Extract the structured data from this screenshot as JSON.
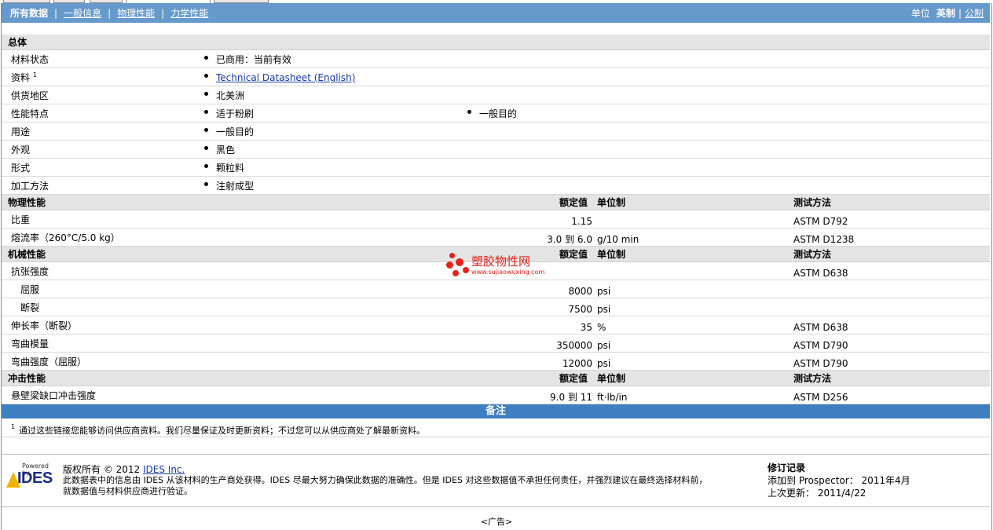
{
  "nav": {
    "items": [
      "所有数据",
      "一般信息",
      "物理性能",
      "力学性能"
    ],
    "units_label": "单位",
    "units_current": "英制",
    "units_other": "公制"
  },
  "general": {
    "title": "总体",
    "rows": [
      {
        "label": "材料状态",
        "value": "已商用：当前有效"
      },
      {
        "label": "资料",
        "sup": "1",
        "value": "Technical Datasheet (English)"
      },
      {
        "label": "供货地区",
        "value": "北美洲"
      },
      {
        "label": "性能特点",
        "value": "适于粉刷",
        "value2": "一般目的"
      },
      {
        "label": "用途",
        "value": "一般目的"
      },
      {
        "label": "外观",
        "value": "黑色"
      },
      {
        "label": "形式",
        "value": "颗粒料"
      },
      {
        "label": "加工方法",
        "value": "注射成型"
      }
    ]
  },
  "headers": {
    "nominal": "额定值",
    "unit": "单位制",
    "method": "测试方法"
  },
  "physical": {
    "title": "物理性能",
    "rows": [
      {
        "label": "比重",
        "value": "1.15",
        "unit": "",
        "method": "ASTM D792"
      },
      {
        "label": "熔流率（260°C/5.0 kg）",
        "value": "3.0 到  6.0",
        "unit": "g/10 min",
        "method": "ASTM D1238"
      }
    ]
  },
  "mechanical": {
    "title": "机械性能",
    "rows": [
      {
        "label": "抗张强度",
        "value": "",
        "unit": "",
        "method": "ASTM D638"
      },
      {
        "label": "屈服",
        "value": "8000",
        "unit": "psi",
        "method": ""
      },
      {
        "label": "断裂",
        "value": "7500",
        "unit": "psi",
        "method": ""
      },
      {
        "label": "伸长率（断裂）",
        "value": "35",
        "unit": "%",
        "method": "ASTM D638"
      },
      {
        "label": "弯曲模量",
        "value": "350000",
        "unit": "psi",
        "method": "ASTM D790"
      },
      {
        "label": "弯曲强度（屈服）",
        "value": "12000",
        "unit": "psi",
        "method": "ASTM D790"
      }
    ]
  },
  "impact": {
    "title": "冲击性能",
    "rows": [
      {
        "label": "悬壁梁缺口冲击强度",
        "value": "9.0 到  11",
        "unit": "ft·lb/in",
        "method": "ASTM D256"
      }
    ]
  },
  "notes": {
    "title": "备注",
    "sup": "1",
    "text": "通过这些链接您能够访问供应商资料。我们尽量保证及时更新资料；不过您可以从供应商处了解最新资料。"
  },
  "footer": {
    "logo_powered": "Powered by",
    "logo_name": "IDES",
    "copyright_prefix": "版权所有  © 2012 ",
    "copyright_link": "IDES Inc.",
    "line2": "此数据表中的信息由  IDES 从该材料的生产商处获得。IDES 尽最大努力确保此数据的准确性。但是  IDES 对这些数据值不承担任何责任，并强烈建议在最终选择材料前，",
    "line3": "就数据值与材料供应商进行验证。",
    "history_title": "修订记录",
    "history_added": "添加到  Prospector：  2011年4月",
    "history_updated": "上次更新：  2011/4/22"
  },
  "ad": "<广告>",
  "watermark": {
    "name": "塑胶物性网",
    "url": "www.sujiaowuxing.com"
  }
}
